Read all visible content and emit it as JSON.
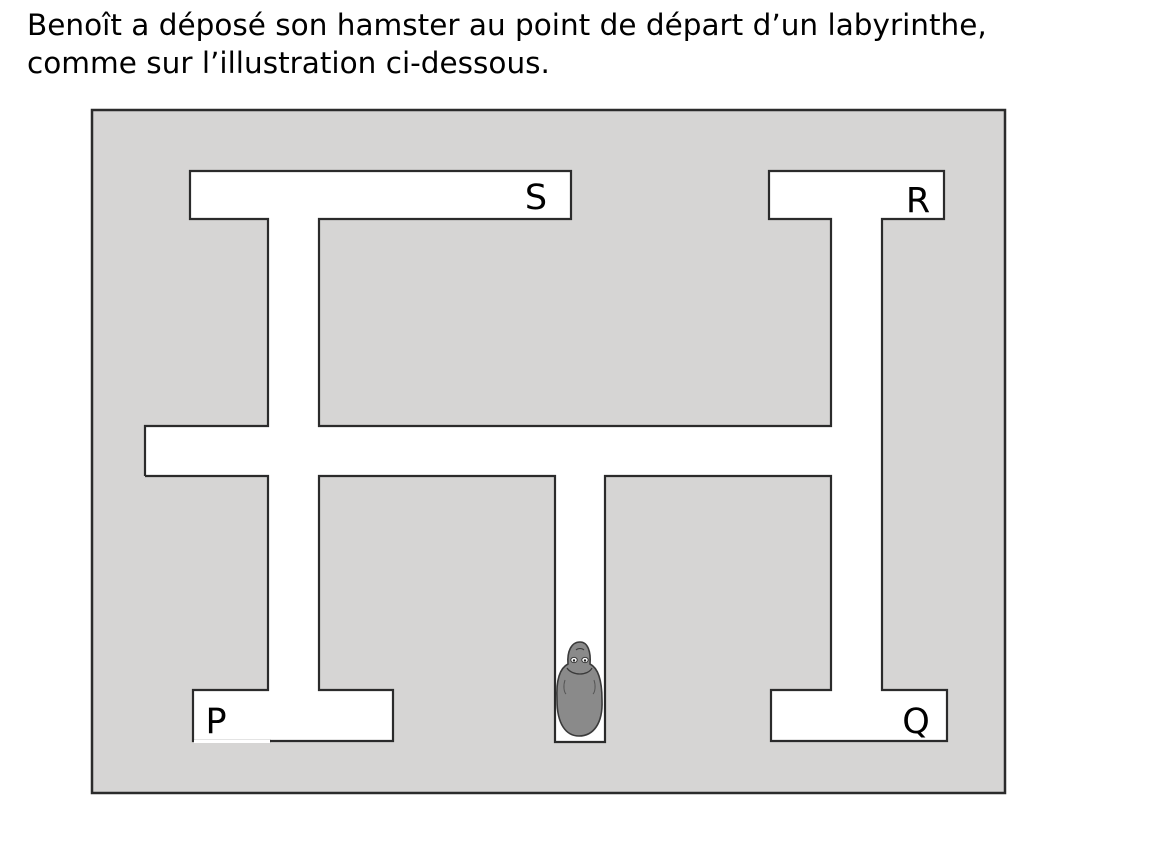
{
  "intro": {
    "line1": "Benoît a déposé son hamster au point de départ d’un labyrinthe,",
    "line2": "comme sur l’illustration ci-dessous."
  },
  "maze": {
    "labels": {
      "s": "S",
      "r": "R",
      "p": "P",
      "q": "Q"
    },
    "colors": {
      "wall": "#d6d5d4",
      "path": "#ffffff",
      "stroke": "#2b2b2b",
      "hamster": "#8a8a8a"
    }
  }
}
